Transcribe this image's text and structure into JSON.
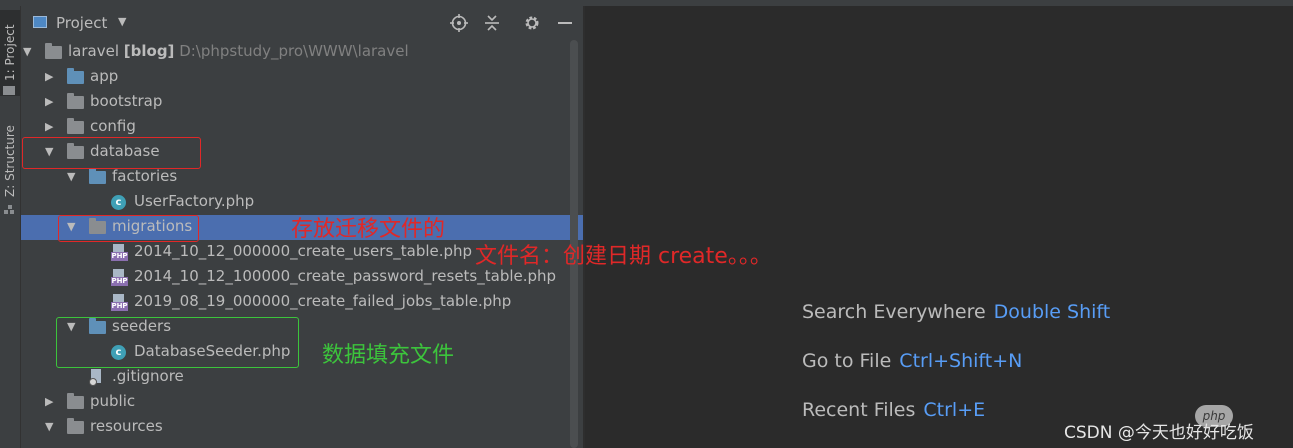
{
  "toolwindow_tabs": [
    "1: Project",
    "Z: Structure"
  ],
  "panel": {
    "title": "Project",
    "icons": [
      "locate-icon",
      "collapse-icon",
      "gear-icon",
      "minimize-icon"
    ]
  },
  "tree": [
    {
      "name": "laravel",
      "bold": "[blog]",
      "path": "D:\\phpstudy_pro\\WWW\\laravel",
      "expanded": true,
      "icon": "folder"
    },
    {
      "name": "app",
      "expanded": false,
      "icon": "folder-blue"
    },
    {
      "name": "bootstrap",
      "expanded": false,
      "icon": "folder"
    },
    {
      "name": "config",
      "expanded": false,
      "icon": "folder"
    },
    {
      "name": "database",
      "expanded": true,
      "icon": "folder"
    },
    {
      "name": "factories",
      "expanded": true,
      "icon": "folder-blue"
    },
    {
      "name": "UserFactory.php",
      "icon": "class"
    },
    {
      "name": "migrations",
      "expanded": true,
      "icon": "folder",
      "selected": true
    },
    {
      "name": "2014_10_12_000000_create_users_table.php",
      "icon": "php"
    },
    {
      "name": "2014_10_12_100000_create_password_resets_table.php",
      "icon": "php"
    },
    {
      "name": "2019_08_19_000000_create_failed_jobs_table.php",
      "icon": "php"
    },
    {
      "name": "seeders",
      "expanded": true,
      "icon": "folder-blue"
    },
    {
      "name": "DatabaseSeeder.php",
      "icon": "class"
    },
    {
      "name": ".gitignore",
      "icon": "git"
    },
    {
      "name": "public",
      "expanded": false,
      "icon": "folder"
    },
    {
      "name": "resources",
      "expanded": true,
      "icon": "folder"
    }
  ],
  "annotations": {
    "migrations_note": "存放迁移文件的",
    "filename_note": "文件名：创建日期 create。。。",
    "seeders_note": "数据填充文件"
  },
  "editor_tips": [
    {
      "label": "Search Everywhere",
      "shortcut": "Double Shift"
    },
    {
      "label": "Go to File",
      "shortcut": "Ctrl+Shift+N"
    },
    {
      "label": "Recent Files",
      "shortcut": "Ctrl+E"
    }
  ],
  "watermark": "CSDN @今天也好好吃饭",
  "badge": "php",
  "colors": {
    "selection": "#4b6eaf",
    "annotation_red": "#e02828",
    "annotation_green": "#3cc43c",
    "shortcut_blue": "#589df6"
  }
}
